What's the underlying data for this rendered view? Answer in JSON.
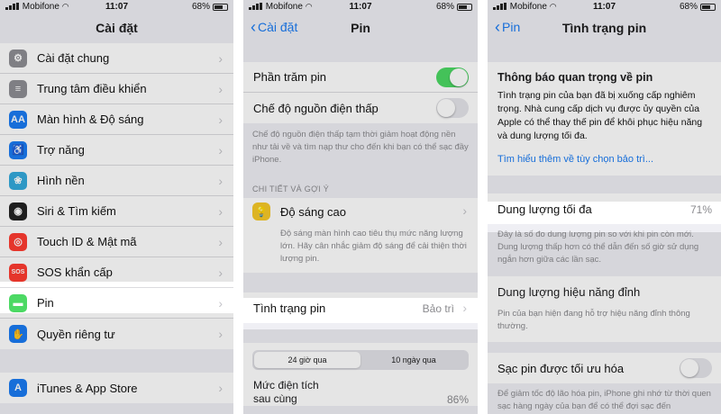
{
  "status": {
    "carrier": "Mobifone",
    "time": "11:07",
    "battery": "68%",
    "battery_level": 0.68
  },
  "panel1": {
    "title": "Cài đặt",
    "items": [
      {
        "label": "Cài đặt chung",
        "icon": "gear-icon",
        "color": "#8e8e93"
      },
      {
        "label": "Trung tâm điều khiển",
        "icon": "toggles-icon",
        "color": "#8e8e93"
      },
      {
        "label": "Màn hình & Độ sáng",
        "icon": "aa-icon",
        "color": "#1a7bf2"
      },
      {
        "label": "Trợ năng",
        "icon": "accessibility-icon",
        "color": "#1a7bf2"
      },
      {
        "label": "Hình nền",
        "icon": "flower-icon",
        "color": "#34aadc"
      },
      {
        "label": "Siri & Tìm kiếm",
        "icon": "siri-icon",
        "color": "#222222"
      },
      {
        "label": "Touch ID & Mật mã",
        "icon": "fingerprint-icon",
        "color": "#ff3b30"
      },
      {
        "label": "SOS khẩn cấp",
        "icon": "sos-icon",
        "color": "#ff3b30"
      },
      {
        "label": "Pin",
        "icon": "battery-icon",
        "color": "#4cd964"
      },
      {
        "label": "Quyền riêng tư",
        "icon": "hand-icon",
        "color": "#1a7bf2"
      },
      {
        "label": "iTunes & App Store",
        "icon": "app-store-icon",
        "color": "#1a7bf2"
      }
    ],
    "icon_glyphs": [
      "⚙",
      "≡",
      "AA",
      "♿",
      "❀",
      "◉",
      "◎",
      "SOS",
      "▬",
      "✋",
      "A"
    ]
  },
  "panel2": {
    "back": "Cài đặt",
    "title": "Pin",
    "battery_percentage_label": "Phần trăm pin",
    "battery_percentage_on": true,
    "low_power_label": "Chế độ nguồn điện thấp",
    "low_power_on": false,
    "low_power_desc": "Chế độ nguồn điện thấp tạm thời giảm hoạt động nền như tải về và tìm nạp thư cho đến khi bạn có thể sạc đầy iPhone.",
    "insights_header": "CHI TIẾT VÀ GỢI Ý",
    "brightness_label": "Độ sáng cao",
    "brightness_desc": "Độ sáng màn hình cao tiêu thụ mức năng lượng lớn. Hãy cân nhắc giảm độ sáng để cải thiện thời lượng pin.",
    "health_label": "Tình trạng pin",
    "health_value": "Bảo trì",
    "seg_tabs": [
      "24 giờ qua",
      "10 ngày qua"
    ],
    "last_charge_line1": "Mức điện tích",
    "last_charge_line2": "sau cùng",
    "last_charge_value": "86%"
  },
  "panel3": {
    "back": "Pin",
    "title": "Tình trạng pin",
    "notice_title": "Thông báo quan trọng về pin",
    "notice_body": "Tình trạng pin của bạn đã bị xuống cấp nghiêm trọng. Nhà cung cấp dịch vụ được ủy quyền của Apple có thể thay thế pin để khôi phục hiệu năng và dung lượng tối đa.",
    "notice_link": "Tìm hiểu thêm về tùy chọn bảo trì...",
    "max_capacity_label": "Dung lượng tối đa",
    "max_capacity_value": "71%",
    "max_capacity_desc": "Đây là số đo dung lượng pin so với khi pin còn mới. Dung lượng thấp hơn có thể dẫn đến số giờ sử dụng ngắn hơn giữa các lần sạc.",
    "peak_label": "Dung lượng hiệu năng đỉnh",
    "peak_desc": "Pin của bạn hiện đang hỗ trợ hiệu năng đỉnh thông thường.",
    "optimized_label": "Sạc pin được tối ưu hóa",
    "optimized_on": false,
    "optimized_desc": "Để giảm tốc độ lão hóa pin, iPhone ghi nhớ từ thời quen sạc hàng ngày của bạn để có thể đợi sạc đến"
  }
}
